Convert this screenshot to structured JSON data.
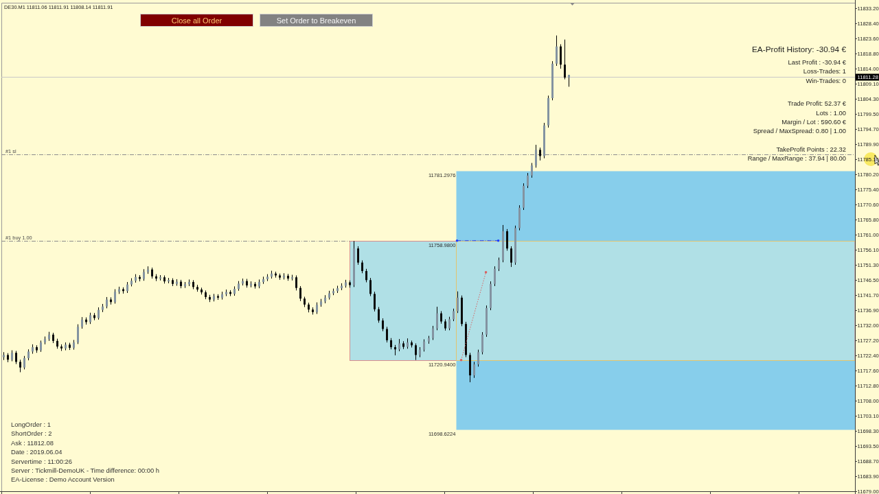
{
  "chart_header": "DE30.M1 11811.06 11811.91 11808.14 11811.91",
  "buttons": [
    {
      "label": "Close all Order",
      "kind": "close_all"
    },
    {
      "label": "Set Order to Breakeven",
      "kind": "breakeven"
    }
  ],
  "profit_panel": {
    "title": "EA-Profit History: -30.94 €",
    "groups": [
      [
        "Last Profit : -30.94 €",
        "Loss-Trades: 1",
        "Win-Trades: 0"
      ],
      [
        "Trade Profit: 52.37 €",
        "Lots : 1.00",
        "Margin / Lot : 590.60 €",
        "Spread / MaxSpread: 0.80 | 1.00"
      ],
      [
        "TakeProfit Points : 22.32",
        "Range / MaxRange : 37.94 | 80.00"
      ]
    ]
  },
  "status_panel": [
    "LongOrder : 1",
    "ShortOrder : 2",
    "Ask : 11812.08",
    "Date : 2019.06.04",
    "Servertime : 11:00:26",
    "Server : Tickmill-DemoUK - Time difference: 00:00 h",
    "EA-License : Demo Account Version"
  ],
  "chart": {
    "chart_data": [
      {
        "type": "candlestick",
        "tick_labels": "y",
        "ylim": [
          11679.0,
          11834.73
        ],
        "yticks": [
          {
            "value": 11833.2,
            "label": "11833.20"
          },
          {
            "value": 11828.4,
            "label": "11828.40"
          },
          {
            "value": 11823.6,
            "label": "11823.60"
          },
          {
            "value": 11818.8,
            "label": "11818.80"
          },
          {
            "value": 11814.0,
            "label": "11814.00"
          },
          {
            "value": 11809.1,
            "label": "11809.10"
          },
          {
            "value": 11804.3,
            "label": "11804.30"
          },
          {
            "value": 11799.5,
            "label": "11799.50"
          },
          {
            "value": 11794.7,
            "label": "11794.70"
          },
          {
            "value": 11789.9,
            "label": "11789.90"
          },
          {
            "value": 11785.1,
            "label": "11785.10"
          },
          {
            "value": 11780.2,
            "label": "11780.20"
          },
          {
            "value": 11775.4,
            "label": "11775.40"
          },
          {
            "value": 11770.6,
            "label": "11770.60"
          },
          {
            "value": 11765.8,
            "label": "11765.80"
          },
          {
            "value": 11761.0,
            "label": "11761.00"
          },
          {
            "value": 11756.1,
            "label": "11756.10"
          },
          {
            "value": 11751.3,
            "label": "11751.30"
          },
          {
            "value": 11746.5,
            "label": "11746.50"
          },
          {
            "value": 11741.7,
            "label": "11741.70"
          },
          {
            "value": 11736.9,
            "label": "11736.90"
          },
          {
            "value": 11732.0,
            "label": "11732.00"
          },
          {
            "value": 11727.2,
            "label": "11727.20"
          },
          {
            "value": 11722.4,
            "label": "11722.40"
          },
          {
            "value": 11717.6,
            "label": "11717.60"
          },
          {
            "value": 11712.8,
            "label": "11712.80"
          },
          {
            "value": 11708.0,
            "label": "11708.00"
          },
          {
            "value": 11703.1,
            "label": "11703.10"
          },
          {
            "value": 11698.3,
            "label": "11698.30"
          },
          {
            "value": 11693.5,
            "label": "11693.50"
          },
          {
            "value": 11688.7,
            "label": "11688.70"
          },
          {
            "value": 11683.9,
            "label": "11683.90"
          },
          {
            "value": 11679.0,
            "label": "11679.00"
          }
        ],
        "ref_lines": [
          {
            "axis": "y",
            "value": 11811.28,
            "label": "11811.28",
            "color": "#c8c8c8",
            "line_style": "solid"
          },
          {
            "axis": "y",
            "value": 11786.5,
            "label": "#1 sl",
            "color": "#8c8c8c",
            "line_style": "dashdot"
          },
          {
            "axis": "y",
            "value": 11759.0,
            "label": "#1 buy 1.00",
            "color": "#8c8c8c",
            "line_style": "dashdot"
          }
        ],
        "bands": [
          {
            "axis": "y",
            "from": 11698.6224,
            "to": 11781.2976,
            "color": "#87ceeb"
          },
          {
            "axis": "y",
            "from": 11720.94,
            "to": 11758.98,
            "color": "#b0e0e6"
          }
        ],
        "annotations": [
          "11781.2976",
          "11758.9800",
          "11720.9400",
          "11698.6224"
        ],
        "categories": [
          null,
          null,
          null,
          null,
          null,
          null,
          null,
          null,
          null,
          null,
          null,
          null,
          null,
          null,
          null,
          null,
          null,
          null,
          null,
          null,
          null,
          null,
          null,
          null,
          null,
          null,
          null,
          null,
          null,
          null,
          null,
          null,
          null,
          null,
          null,
          null,
          null,
          null,
          null,
          null,
          null,
          null,
          null,
          null,
          null,
          null,
          null,
          null,
          null,
          null,
          null,
          null,
          null,
          null,
          null,
          null,
          null,
          null,
          null,
          null,
          null,
          null,
          null,
          null,
          null,
          null,
          null,
          null,
          null,
          null,
          null,
          null,
          null,
          null,
          null,
          null,
          null,
          null,
          null,
          null,
          null,
          null,
          null,
          null,
          null,
          null,
          null,
          null,
          null,
          null,
          null,
          null,
          null,
          null,
          null,
          null,
          null,
          null,
          null,
          null,
          null,
          null,
          null,
          null,
          null,
          null,
          null,
          null,
          null,
          null,
          null,
          null,
          null,
          null,
          null,
          null,
          null,
          null,
          null,
          null,
          null,
          null,
          null,
          null,
          null,
          null,
          null,
          null,
          null,
          null,
          null,
          null,
          null,
          null,
          null,
          null,
          null,
          null,
          null,
          null,
          null,
          null,
          null,
          null,
          null,
          null,
          null,
          null,
          null,
          null,
          null,
          null,
          null,
          null,
          null,
          null,
          null,
          null,
          null,
          null,
          null,
          null,
          null,
          null,
          null,
          null,
          null,
          null,
          null,
          null,
          null,
          null,
          null,
          null,
          null,
          null,
          null,
          null,
          null,
          null,
          null,
          null,
          null,
          null,
          null,
          null,
          null,
          null,
          null,
          null,
          null,
          null,
          null,
          null,
          null,
          null,
          null,
          null,
          null,
          null,
          null,
          null,
          null,
          null,
          null,
          null,
          null
        ],
        "ohlc": [
          [
            11721.8,
            11723.4,
            11720.9,
            11722.5
          ],
          [
            11722.5,
            11723.1,
            11720.2,
            11721.0
          ],
          [
            11721.0,
            11724.0,
            11720.5,
            11723.2
          ],
          [
            11723.2,
            11723.8,
            11719.6,
            11720.3
          ],
          [
            11720.3,
            11721.0,
            11717.0,
            11718.5
          ],
          [
            11718.5,
            11722.2,
            11717.9,
            11721.5
          ],
          [
            11721.5,
            11724.3,
            11720.8,
            11723.6
          ],
          [
            11723.6,
            11725.9,
            11722.9,
            11725.0
          ],
          [
            11725.0,
            11725.6,
            11723.2,
            11724.0
          ],
          [
            11724.0,
            11727.1,
            11723.5,
            11726.5
          ],
          [
            11726.5,
            11728.4,
            11725.9,
            11727.6
          ],
          [
            11727.6,
            11729.9,
            11727.0,
            11729.0
          ],
          [
            11729.0,
            11729.6,
            11726.3,
            11727.0
          ],
          [
            11727.0,
            11727.7,
            11724.5,
            11725.2
          ],
          [
            11725.2,
            11725.9,
            11723.8,
            11724.6
          ],
          [
            11724.6,
            11726.5,
            11724.0,
            11725.8
          ],
          [
            11725.8,
            11726.4,
            11724.1,
            11724.8
          ],
          [
            11724.8,
            11727.3,
            11724.2,
            11726.5
          ],
          [
            11726.5,
            11732.3,
            11726.0,
            11731.5
          ],
          [
            11731.5,
            11734.6,
            11730.9,
            11733.8
          ],
          [
            11733.8,
            11734.5,
            11732.2,
            11733.0
          ],
          [
            11733.0,
            11736.0,
            11732.4,
            11735.2
          ],
          [
            11735.2,
            11735.9,
            11733.6,
            11734.3
          ],
          [
            11734.3,
            11737.7,
            11733.8,
            11736.9
          ],
          [
            11736.9,
            11738.8,
            11736.2,
            11738.0
          ],
          [
            11738.0,
            11741.0,
            11737.4,
            11740.2
          ],
          [
            11740.2,
            11740.9,
            11738.6,
            11739.4
          ],
          [
            11739.4,
            11743.5,
            11738.9,
            11742.7
          ],
          [
            11742.7,
            11744.3,
            11742.0,
            11743.5
          ],
          [
            11743.5,
            11744.1,
            11742.1,
            11742.9
          ],
          [
            11742.9,
            11745.8,
            11742.3,
            11745.0
          ],
          [
            11745.0,
            11747.0,
            11744.4,
            11746.2
          ],
          [
            11746.2,
            11748.3,
            11745.6,
            11747.4
          ],
          [
            11747.4,
            11748.0,
            11746.0,
            11746.8
          ],
          [
            11746.8,
            11749.9,
            11746.2,
            11749.0
          ],
          [
            11749.0,
            11750.8,
            11748.4,
            11749.8
          ],
          [
            11749.8,
            11750.4,
            11746.9,
            11747.6
          ],
          [
            11747.6,
            11748.3,
            11746.1,
            11746.9
          ],
          [
            11746.9,
            11748.0,
            11746.3,
            11747.3
          ],
          [
            11747.3,
            11747.9,
            11745.3,
            11746.0
          ],
          [
            11746.0,
            11747.1,
            11745.4,
            11746.4
          ],
          [
            11746.4,
            11747.0,
            11744.5,
            11745.2
          ],
          [
            11745.2,
            11746.7,
            11744.6,
            11745.9
          ],
          [
            11745.9,
            11746.5,
            11743.8,
            11744.5
          ],
          [
            11744.5,
            11745.8,
            11743.9,
            11745.1
          ],
          [
            11745.1,
            11746.6,
            11744.5,
            11745.8
          ],
          [
            11745.8,
            11746.4,
            11743.5,
            11744.2
          ],
          [
            11744.2,
            11744.9,
            11742.7,
            11743.4
          ],
          [
            11743.4,
            11744.0,
            11741.8,
            11742.5
          ],
          [
            11742.5,
            11743.1,
            11740.3,
            11741.0
          ],
          [
            11741.0,
            11741.7,
            11739.4,
            11740.2
          ],
          [
            11740.2,
            11742.0,
            11739.6,
            11741.3
          ],
          [
            11741.3,
            11741.9,
            11740.1,
            11740.8
          ],
          [
            11740.8,
            11742.7,
            11740.2,
            11741.9
          ],
          [
            11741.9,
            11743.4,
            11741.3,
            11742.6
          ],
          [
            11742.6,
            11743.2,
            11741.3,
            11742.0
          ],
          [
            11742.0,
            11744.4,
            11741.4,
            11743.6
          ],
          [
            11743.6,
            11746.1,
            11743.0,
            11745.3
          ],
          [
            11745.3,
            11746.9,
            11744.7,
            11746.1
          ],
          [
            11746.1,
            11746.8,
            11744.0,
            11744.7
          ],
          [
            11744.7,
            11746.0,
            11744.1,
            11745.2
          ],
          [
            11745.2,
            11745.8,
            11743.7,
            11744.4
          ],
          [
            11744.4,
            11746.6,
            11743.8,
            11745.8
          ],
          [
            11745.8,
            11747.5,
            11745.2,
            11746.7
          ],
          [
            11746.7,
            11748.3,
            11746.1,
            11747.5
          ],
          [
            11747.5,
            11749.4,
            11746.9,
            11748.5
          ],
          [
            11748.5,
            11749.1,
            11747.2,
            11747.9
          ],
          [
            11747.9,
            11748.5,
            11746.5,
            11747.2
          ],
          [
            11747.2,
            11748.6,
            11746.6,
            11747.8
          ],
          [
            11747.8,
            11748.4,
            11746.2,
            11746.9
          ],
          [
            11746.9,
            11748.1,
            11746.3,
            11747.3
          ],
          [
            11747.3,
            11747.9,
            11743.1,
            11743.9
          ],
          [
            11743.9,
            11744.5,
            11739.7,
            11740.5
          ],
          [
            11740.5,
            11741.1,
            11737.8,
            11738.6
          ],
          [
            11738.6,
            11739.2,
            11736.1,
            11737.0
          ],
          [
            11737.0,
            11737.7,
            11735.4,
            11736.2
          ],
          [
            11736.2,
            11739.3,
            11735.6,
            11738.5
          ],
          [
            11738.5,
            11740.4,
            11737.9,
            11739.6
          ],
          [
            11739.6,
            11741.6,
            11739.0,
            11740.8
          ],
          [
            11740.8,
            11743.0,
            11740.2,
            11742.2
          ],
          [
            11742.2,
            11743.7,
            11741.6,
            11742.9
          ],
          [
            11742.9,
            11744.6,
            11742.3,
            11743.8
          ],
          [
            11743.8,
            11745.4,
            11743.2,
            11744.6
          ],
          [
            11744.6,
            11746.5,
            11744.0,
            11745.7
          ],
          [
            11745.7,
            11746.3,
            11744.0,
            11744.8
          ],
          [
            11744.8,
            11758.9,
            11744.2,
            11756.5
          ],
          [
            11756.5,
            11757.2,
            11751.3,
            11752.0
          ],
          [
            11752.0,
            11752.7,
            11748.6,
            11749.3
          ],
          [
            11749.3,
            11750.0,
            11745.7,
            11746.4
          ],
          [
            11746.4,
            11747.1,
            11741.3,
            11742.0
          ],
          [
            11742.0,
            11742.7,
            11736.4,
            11737.1
          ],
          [
            11737.1,
            11737.8,
            11732.8,
            11733.5
          ],
          [
            11733.5,
            11734.2,
            11730.1,
            11730.8
          ],
          [
            11730.8,
            11731.5,
            11726.5,
            11727.2
          ],
          [
            11727.2,
            11727.9,
            11724.3,
            11725.0
          ],
          [
            11725.0,
            11725.7,
            11722.4,
            11724.3
          ],
          [
            11724.3,
            11727.6,
            11723.7,
            11726.2
          ],
          [
            11726.2,
            11726.9,
            11724.4,
            11725.1
          ],
          [
            11725.1,
            11727.8,
            11724.5,
            11726.5
          ],
          [
            11726.5,
            11727.1,
            11724.9,
            11725.6
          ],
          [
            11725.6,
            11726.2,
            11720.9,
            11722.5
          ],
          [
            11722.5,
            11725.0,
            11721.8,
            11724.2
          ],
          [
            11724.2,
            11727.5,
            11723.6,
            11726.8
          ],
          [
            11726.8,
            11728.6,
            11726.1,
            11727.9
          ],
          [
            11727.9,
            11731.8,
            11727.3,
            11731.0
          ],
          [
            11731.0,
            11737.9,
            11730.4,
            11735.8
          ],
          [
            11735.8,
            11736.5,
            11732.5,
            11733.2
          ],
          [
            11733.2,
            11733.9,
            11730.3,
            11731.0
          ],
          [
            11731.0,
            11734.7,
            11730.4,
            11733.9
          ],
          [
            11733.9,
            11737.3,
            11733.3,
            11736.5
          ],
          [
            11736.5,
            11742.8,
            11735.9,
            11740.8
          ],
          [
            11740.8,
            11741.5,
            11731.7,
            11732.4
          ],
          [
            11732.4,
            11733.1,
            11721.8,
            11722.5
          ],
          [
            11722.5,
            11723.2,
            11713.8,
            11716.0
          ],
          [
            11716.0,
            11720.3,
            11715.2,
            11719.5
          ],
          [
            11719.5,
            11724.2,
            11718.8,
            11723.4
          ],
          [
            11723.4,
            11729.8,
            11722.7,
            11729.0
          ],
          [
            11729.0,
            11738.3,
            11728.3,
            11737.5
          ],
          [
            11737.5,
            11746.0,
            11736.8,
            11745.2
          ],
          [
            11745.2,
            11750.8,
            11744.5,
            11750.0
          ],
          [
            11750.0,
            11753.6,
            11749.3,
            11752.8
          ],
          [
            11752.8,
            11764.0,
            11752.1,
            11762.0
          ],
          [
            11762.0,
            11762.7,
            11755.8,
            11756.5
          ],
          [
            11756.5,
            11757.2,
            11750.6,
            11752.0
          ],
          [
            11752.0,
            11763.8,
            11751.3,
            11763.0
          ],
          [
            11763.0,
            11770.3,
            11762.3,
            11769.5
          ],
          [
            11769.5,
            11777.3,
            11768.8,
            11776.5
          ],
          [
            11776.5,
            11780.6,
            11775.8,
            11779.8
          ],
          [
            11779.8,
            11783.8,
            11779.1,
            11783.0
          ],
          [
            11783.0,
            11789.6,
            11782.3,
            11788.0
          ],
          [
            11788.0,
            11788.7,
            11784.6,
            11786.0
          ],
          [
            11786.0,
            11796.6,
            11785.3,
            11795.8
          ],
          [
            11795.8,
            11805.3,
            11795.1,
            11804.5
          ],
          [
            11804.5,
            11816.3,
            11803.8,
            11815.5
          ],
          [
            11815.5,
            11824.5,
            11814.8,
            11821.0
          ],
          [
            11821.0,
            11821.7,
            11813.9,
            11815.2
          ],
          [
            11815.2,
            11823.2,
            11810.5,
            11811.06
          ],
          [
            11811.06,
            11811.91,
            11808.14,
            11811.91
          ],
          null,
          null,
          null,
          null,
          null,
          null,
          null,
          null,
          null,
          null,
          null,
          null,
          null,
          null,
          null,
          null,
          null,
          null,
          null,
          null,
          null,
          null,
          null,
          null,
          null,
          null,
          null,
          null,
          null,
          null,
          null,
          null,
          null,
          null,
          null,
          null,
          null,
          null,
          null,
          null,
          null,
          null,
          null,
          null,
          null,
          null,
          null,
          null,
          null,
          null,
          null,
          null,
          null,
          null,
          null,
          null,
          null,
          null,
          null,
          null,
          null,
          null,
          null,
          null,
          null,
          null,
          null,
          null,
          null
        ],
        "series": [
          {
            "type": "line",
            "color": "#1e3cff",
            "line_style": "dashdot",
            "values": [
              null,
              null,
              null,
              null,
              null,
              null,
              null,
              null,
              null,
              null,
              null,
              null,
              null,
              null,
              null,
              null,
              null,
              null,
              null,
              null,
              null,
              null,
              null,
              null,
              null,
              null,
              null,
              null,
              null,
              null,
              null,
              null,
              null,
              null,
              null,
              null,
              null,
              null,
              null,
              null,
              null,
              null,
              null,
              null,
              null,
              null,
              null,
              null,
              null,
              null,
              null,
              null,
              null,
              null,
              null,
              null,
              null,
              null,
              null,
              null,
              null,
              null,
              null,
              null,
              null,
              null,
              null,
              null,
              null,
              null,
              null,
              null,
              null,
              null,
              null,
              null,
              null,
              null,
              null,
              null,
              null,
              null,
              null,
              null,
              null,
              null,
              null,
              null,
              null,
              null,
              null,
              null,
              null,
              null,
              null,
              null,
              null,
              null,
              null,
              null,
              null,
              null,
              null,
              null,
              null,
              null,
              null,
              null,
              null,
              null,
              11759.0,
              11759.0,
              11759.0,
              11759.0,
              11759.0,
              11759.0,
              11759.0,
              11759.0,
              11759.0,
              11759.0,
              11759.0,
              null,
              null,
              null,
              null,
              null,
              null,
              null,
              null,
              null,
              null,
              null,
              null,
              null,
              null,
              null,
              null,
              null,
              null,
              null,
              null,
              null,
              null,
              null,
              null,
              null,
              null,
              null,
              null,
              null,
              null,
              null,
              null,
              null,
              null,
              null,
              null,
              null,
              null,
              null,
              null,
              null,
              null,
              null,
              null,
              null,
              null,
              null,
              null,
              null,
              null,
              null,
              null,
              null,
              null,
              null,
              null,
              null,
              null,
              null,
              null,
              null,
              null,
              null,
              null,
              null,
              null,
              null,
              null,
              null,
              null,
              null,
              null,
              null,
              null,
              null,
              null,
              null,
              null,
              null,
              null,
              null,
              null,
              null,
              null,
              null,
              null
            ]
          },
          {
            "type": "line",
            "color": "#d86060",
            "line_style": "dotted",
            "values": [
              null,
              null,
              null,
              null,
              null,
              null,
              null,
              null,
              null,
              null,
              null,
              null,
              null,
              null,
              null,
              null,
              null,
              null,
              null,
              null,
              null,
              null,
              null,
              null,
              null,
              null,
              null,
              null,
              null,
              null,
              null,
              null,
              null,
              null,
              null,
              null,
              null,
              null,
              null,
              null,
              null,
              null,
              null,
              null,
              null,
              null,
              null,
              null,
              null,
              null,
              null,
              null,
              null,
              null,
              null,
              null,
              null,
              null,
              null,
              null,
              null,
              null,
              null,
              null,
              null,
              null,
              null,
              null,
              null,
              null,
              null,
              null,
              null,
              null,
              null,
              null,
              null,
              null,
              null,
              null,
              null,
              null,
              null,
              null,
              null,
              null,
              null,
              null,
              null,
              null,
              null,
              null,
              null,
              null,
              null,
              null,
              null,
              null,
              null,
              null,
              null,
              null,
              null,
              null,
              null,
              null,
              null,
              null,
              null,
              null,
              null,
              11720.9,
              11725.6,
              11730.2,
              11734.9,
              11739.6,
              11744.2,
              11748.9,
              null,
              null,
              null,
              null,
              null,
              null,
              null,
              null,
              null,
              null,
              null,
              null,
              null,
              null,
              null,
              null,
              null,
              null,
              null,
              null,
              null,
              null,
              null,
              null,
              null,
              null,
              null,
              null,
              null,
              null,
              null,
              null,
              null,
              null,
              null,
              null,
              null,
              null,
              null,
              null,
              null,
              null,
              null,
              null,
              null,
              null,
              null,
              null,
              null,
              null,
              null,
              null,
              null,
              null,
              null,
              null,
              null,
              null,
              null,
              null,
              null,
              null,
              null,
              null,
              null,
              null,
              null,
              null,
              null,
              null,
              null,
              null,
              null,
              null,
              null,
              null,
              null,
              null,
              null,
              null,
              null,
              null,
              null,
              null,
              null,
              null,
              null,
              null,
              null
            ]
          }
        ]
      }
    ]
  }
}
